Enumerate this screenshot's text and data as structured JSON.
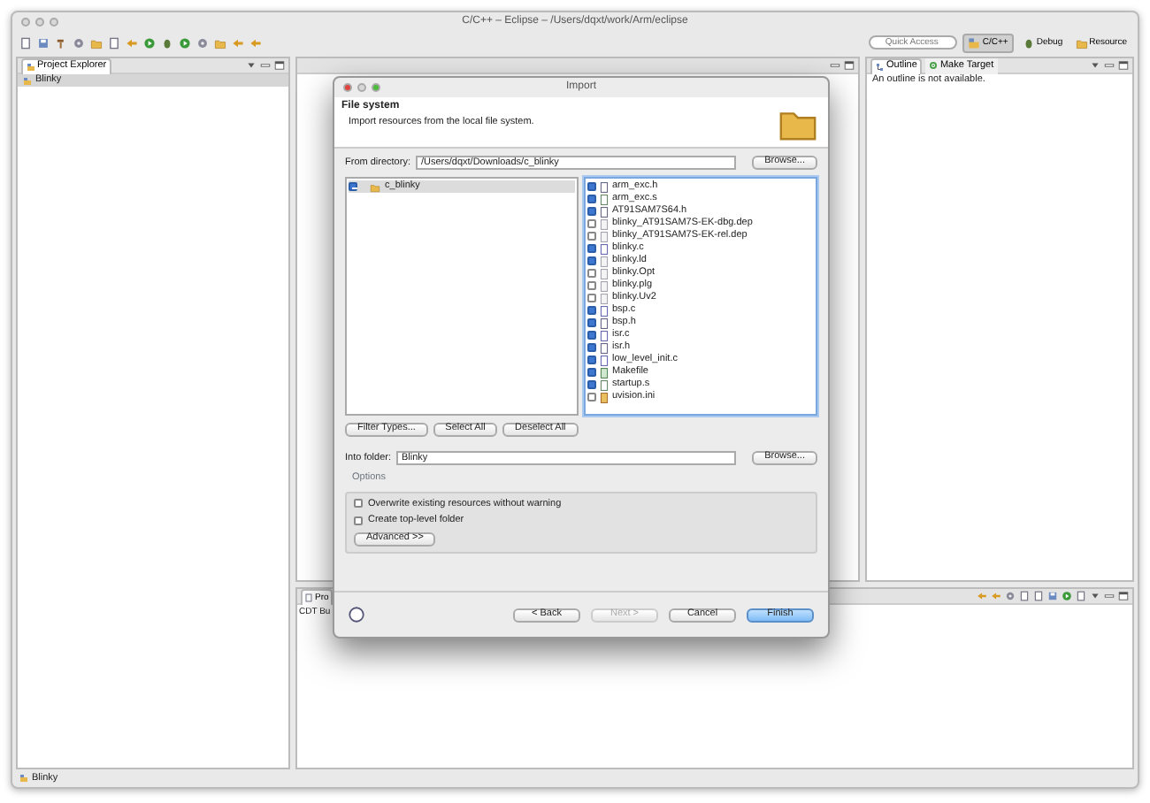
{
  "window": {
    "title": "C/C++ – Eclipse – /Users/dqxt/work/Arm/eclipse"
  },
  "toolbar": {
    "quick_access": {
      "placeholder": "Quick Access"
    },
    "perspectives": [
      {
        "label": "C/C++",
        "selected": true
      },
      {
        "label": "Debug",
        "selected": false
      },
      {
        "label": "Resource",
        "selected": false
      }
    ]
  },
  "project_explorer": {
    "title": "Project Explorer",
    "items": [
      {
        "label": "Blinky",
        "selected": true
      }
    ]
  },
  "outline": {
    "tabs": [
      {
        "label": "Outline",
        "selected": true
      },
      {
        "label": "Make Target",
        "selected": false
      }
    ],
    "message": "An outline is not available."
  },
  "bottom_panel": {
    "tab": "Pro",
    "content": "CDT Bu"
  },
  "status_bar": {
    "text": "Blinky"
  },
  "dialog": {
    "title": "Import",
    "header_title": "File system",
    "description": "Import resources from the local file system.",
    "from_label": "From directory:",
    "from_value": "/Users/dqxt/Downloads/c_blinky",
    "from_browse": "Browse...",
    "folders": [
      {
        "label": "c_blinky",
        "partial": true,
        "selected": true
      }
    ],
    "files": [
      {
        "label": "arm_exc.h",
        "checked": true,
        "kind": "header"
      },
      {
        "label": "arm_exc.s",
        "checked": true,
        "kind": "asm"
      },
      {
        "label": "AT91SAM7S64.h",
        "checked": true,
        "kind": "header"
      },
      {
        "label": "blinky_AT91SAM7S-EK-dbg.dep",
        "checked": false,
        "kind": "plain"
      },
      {
        "label": "blinky_AT91SAM7S-EK-rel.dep",
        "checked": false,
        "kind": "plain"
      },
      {
        "label": "blinky.c",
        "checked": true,
        "kind": "source"
      },
      {
        "label": "blinky.ld",
        "checked": true,
        "kind": "plain"
      },
      {
        "label": "blinky.Opt",
        "checked": false,
        "kind": "plain"
      },
      {
        "label": "blinky.plg",
        "checked": false,
        "kind": "plain"
      },
      {
        "label": "blinky.Uv2",
        "checked": false,
        "kind": "plain"
      },
      {
        "label": "bsp.c",
        "checked": true,
        "kind": "source"
      },
      {
        "label": "bsp.h",
        "checked": true,
        "kind": "header"
      },
      {
        "label": "isr.c",
        "checked": true,
        "kind": "source"
      },
      {
        "label": "isr.h",
        "checked": true,
        "kind": "header"
      },
      {
        "label": "low_level_init.c",
        "checked": true,
        "kind": "source"
      },
      {
        "label": "Makefile",
        "checked": true,
        "kind": "make"
      },
      {
        "label": "startup.s",
        "checked": true,
        "kind": "asm"
      },
      {
        "label": "uvision.ini",
        "checked": false,
        "kind": "ini"
      }
    ],
    "selection_buttons": [
      "Filter Types...",
      "Select All",
      "Deselect All"
    ],
    "into_label": "Into folder:",
    "into_value": "Blinky",
    "into_browse": "Browse...",
    "options_label": "Options",
    "options": [
      {
        "label": "Overwrite existing resources without warning",
        "checked": false
      },
      {
        "label": "Create top-level folder",
        "checked": false
      }
    ],
    "advanced": "Advanced >>",
    "footer_buttons": [
      {
        "label": "< Back",
        "disabled": false,
        "default": false
      },
      {
        "label": "Next >",
        "disabled": true,
        "default": false
      },
      {
        "label": "Cancel",
        "disabled": false,
        "default": false
      },
      {
        "label": "Finish",
        "disabled": false,
        "default": true
      }
    ]
  }
}
